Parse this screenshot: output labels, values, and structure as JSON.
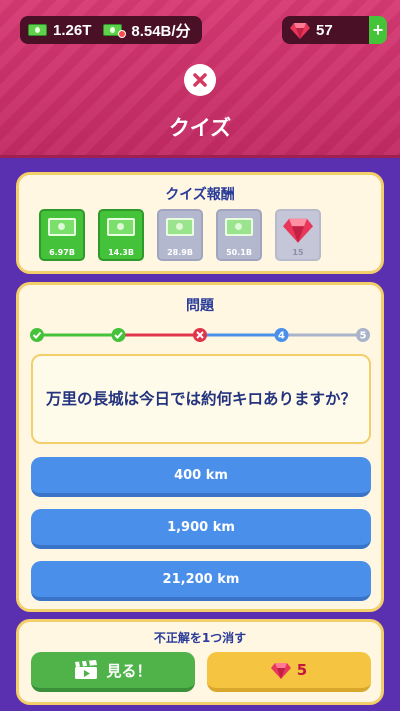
{
  "header": {
    "cash_total": "1.26T",
    "cash_rate": "8.54B/分",
    "gems": "57",
    "plus": "+",
    "title": "クイズ"
  },
  "rewards": {
    "title": "クイズ報酬",
    "items": [
      {
        "label": "6.97B",
        "kind": "cash",
        "state": "earned"
      },
      {
        "label": "14.3B",
        "kind": "cash",
        "state": "earned"
      },
      {
        "label": "28.9B",
        "kind": "cash",
        "state": "locked"
      },
      {
        "label": "50.1B",
        "kind": "cash",
        "state": "locked"
      },
      {
        "label": "15",
        "kind": "gem",
        "state": "locked"
      }
    ]
  },
  "quiz": {
    "title": "問題",
    "progress": [
      {
        "state": "correct"
      },
      {
        "state": "correct"
      },
      {
        "state": "wrong"
      },
      {
        "state": "current",
        "label": "4"
      },
      {
        "state": "pending",
        "label": "5"
      }
    ],
    "question": "万里の長城は今日では約何キロありますか？",
    "answers": [
      "400 km",
      "1,900 km",
      "21,200 km"
    ]
  },
  "hint": {
    "title": "不正解を1つ消す",
    "watch_label": "見る！",
    "gem_cost": "5"
  },
  "colors": {
    "header": "#d63a73",
    "background": "#5a2fb0",
    "card": "#fff7e2",
    "answer": "#4a90ea",
    "correct": "#44c23a",
    "wrong": "#e0344a",
    "current": "#4a90ea",
    "pending": "#a9b3c9"
  }
}
